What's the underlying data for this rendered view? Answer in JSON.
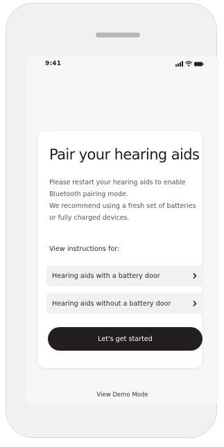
{
  "status_bar": {
    "time": "9:41",
    "icons": [
      "cellular-signal-icon",
      "wifi-icon",
      "battery-icon"
    ]
  },
  "card": {
    "title": "Pair your hearing aids",
    "body_line_1": "Please restart your hearing aids to enable Bluetooth pairing mode.",
    "body_line_2": "We recommend using a fresh set of batteries or fully charged devices.",
    "instructions_label": "View instructions for:",
    "options": [
      {
        "label": "Hearing aids with a battery door",
        "icon": "chevron-right-icon"
      },
      {
        "label": "Hearing aids without a battery door",
        "icon": "chevron-right-icon"
      }
    ],
    "primary_button_label": "Let's get started"
  },
  "footer": {
    "demo_link_label": "View Demo Mode"
  },
  "colors": {
    "primary_button": "#231f20",
    "option_background": "#f1f1f1",
    "screen_background": "#f7f7f7",
    "device_frame": "#f1f1f1"
  }
}
